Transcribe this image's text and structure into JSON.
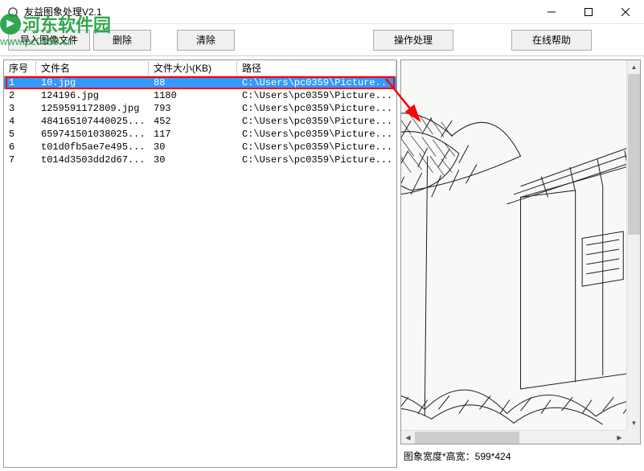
{
  "window": {
    "title": "友益图象处理V2.1"
  },
  "toolbar": {
    "import_label": "导入图像文件",
    "delete_label": "删除",
    "clear_label": "清除",
    "process_label": "操作处理",
    "help_label": "在线帮助"
  },
  "table": {
    "headers": {
      "seq": "序号",
      "name": "文件名",
      "size": "文件大小(KB)",
      "path": "路径"
    },
    "rows": [
      {
        "seq": "1",
        "name": "10.jpg",
        "size": "88",
        "path": "C:\\Users\\pc0359\\Picture...",
        "selected": true
      },
      {
        "seq": "2",
        "name": "124196.jpg",
        "size": "1180",
        "path": "C:\\Users\\pc0359\\Picture..."
      },
      {
        "seq": "3",
        "name": "1259591172809.jpg",
        "size": "793",
        "path": "C:\\Users\\pc0359\\Picture..."
      },
      {
        "seq": "4",
        "name": "484165107440025...",
        "size": "452",
        "path": "C:\\Users\\pc0359\\Picture..."
      },
      {
        "seq": "5",
        "name": "659741501038025...",
        "size": "117",
        "path": "C:\\Users\\pc0359\\Picture..."
      },
      {
        "seq": "6",
        "name": "t01d0fb5ae7e495...",
        "size": "30",
        "path": "C:\\Users\\pc0359\\Picture..."
      },
      {
        "seq": "7",
        "name": "t014d3503dd2d67...",
        "size": "30",
        "path": "C:\\Users\\pc0359\\Picture..."
      }
    ]
  },
  "preview": {
    "status": "图象宽度*高宽：599*424"
  },
  "watermark": {
    "text": "河东软件园",
    "url": "www.pc0359.cn"
  }
}
